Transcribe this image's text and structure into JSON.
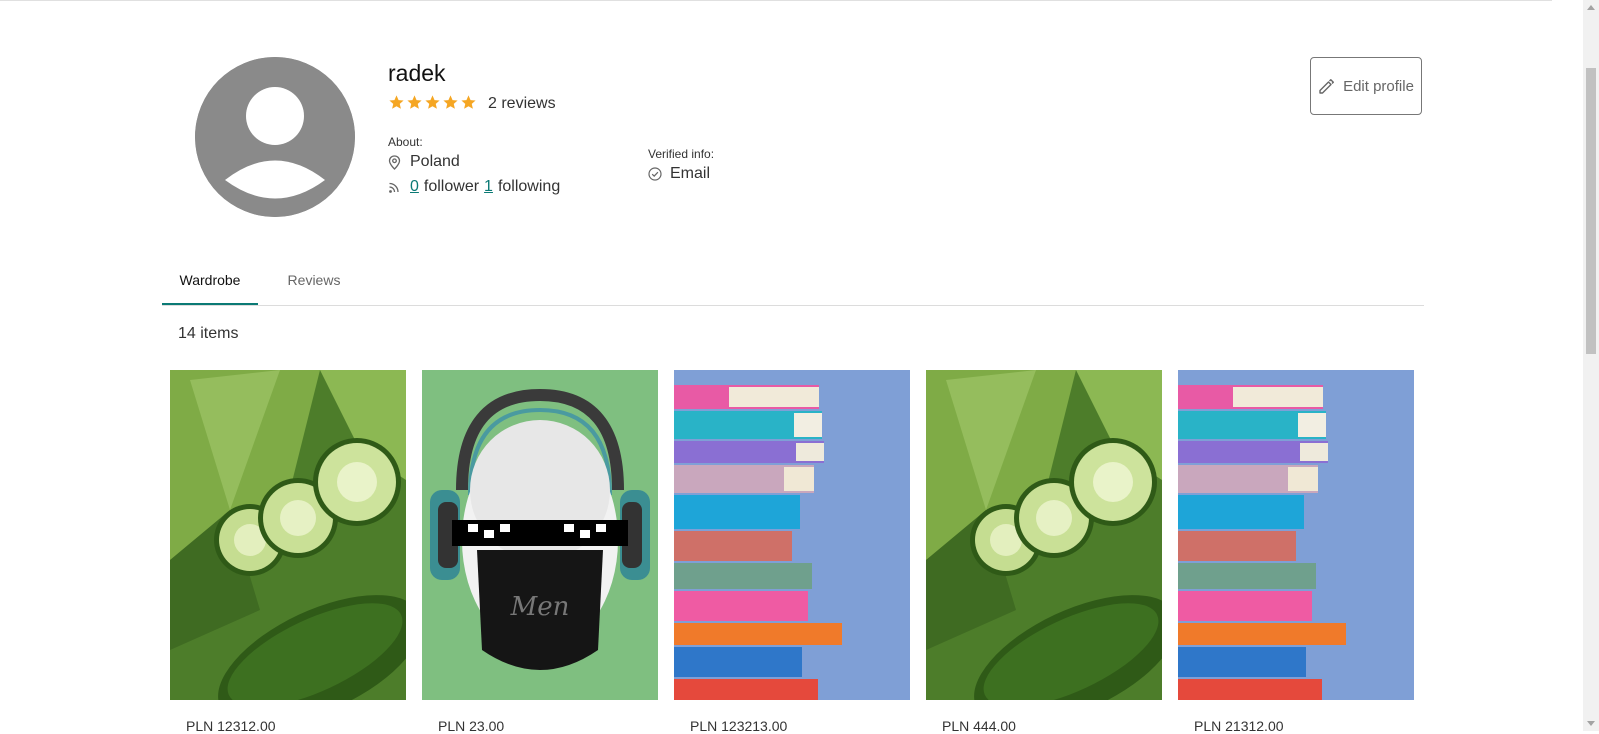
{
  "profile": {
    "username": "radek",
    "rating_stars": 5,
    "reviews_count": "2 reviews",
    "about_label": "About:",
    "location": "Poland",
    "follower_count": "0",
    "follower_label": "follower",
    "following_count": "1",
    "following_label": "following",
    "verified_label": "Verified info:",
    "verified_email": "Email",
    "edit_button": "Edit profile"
  },
  "tabs": [
    {
      "label": "Wardrobe",
      "active": true
    },
    {
      "label": "Reviews",
      "active": false
    }
  ],
  "items_count": "14 items",
  "items": [
    {
      "image": "cucumber-lettuce-photo",
      "price": "PLN 12312.00"
    },
    {
      "image": "skull-headphones-mask-illustration",
      "price": "PLN 23.00"
    },
    {
      "image": "book-stack-photo",
      "price": "PLN 123213.00"
    },
    {
      "image": "cucumber-lettuce-photo",
      "price": "PLN 444.00"
    },
    {
      "image": "book-stack-photo",
      "price": "PLN 21312.00"
    }
  ],
  "colors": {
    "accent": "#0b7a75",
    "star": "#f5a623",
    "avatar": "#8a8a8a"
  }
}
